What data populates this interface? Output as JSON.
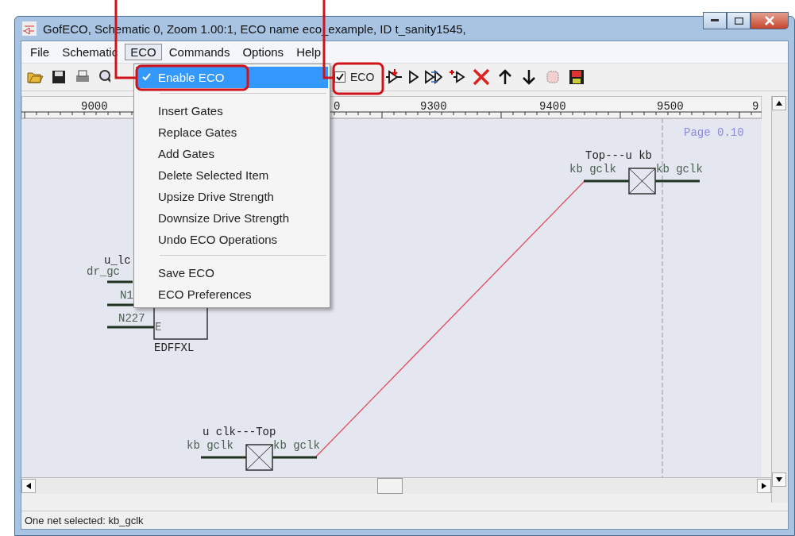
{
  "window": {
    "title": "GofECO, Schematic 0, Zoom 1.00:1, ECO name eco_example, ID t_sanity1545,"
  },
  "menu_bar": [
    {
      "label": "File",
      "selected": false
    },
    {
      "label": "Schematic",
      "selected": false
    },
    {
      "label": "ECO",
      "selected": true
    },
    {
      "label": "Commands",
      "selected": false
    },
    {
      "label": "Options",
      "selected": false
    },
    {
      "label": "Help",
      "selected": false
    }
  ],
  "toolbar": {
    "eco_checkbox": {
      "label": "ECO",
      "checked": true
    }
  },
  "eco_menu": {
    "groups": [
      [
        {
          "label": "Enable ECO",
          "checked": true,
          "selected": true
        }
      ],
      [
        {
          "label": "Insert Gates",
          "checked": false,
          "selected": false
        },
        {
          "label": "Replace Gates",
          "checked": false,
          "selected": false
        },
        {
          "label": "Add Gates",
          "checked": false,
          "selected": false
        },
        {
          "label": "Delete Selected Item",
          "checked": false,
          "selected": false
        },
        {
          "label": "Upsize Drive Strength",
          "checked": false,
          "selected": false
        },
        {
          "label": "Downsize Drive Strength",
          "checked": false,
          "selected": false
        },
        {
          "label": "Undo ECO Operations",
          "checked": false,
          "selected": false
        }
      ],
      [
        {
          "label": "Save ECO",
          "checked": false,
          "selected": false
        },
        {
          "label": "ECO Preferences",
          "checked": false,
          "selected": false
        }
      ]
    ]
  },
  "ruler": {
    "labels": [
      "9000",
      "0",
      "9300",
      "9400",
      "9500",
      "9"
    ]
  },
  "canvas": {
    "page_label": "Page 0.10",
    "left_instance": {
      "name": "u_lc",
      "pin_top": "dr_gc",
      "net_1": "N1",
      "net_2": "N227",
      "pin_e": "E",
      "cell": "EDFFXL"
    },
    "port_top": {
      "name": "Top---u kb",
      "left_pin": "kb gclk",
      "right_pin": "kb gclk"
    },
    "port_bottom": {
      "name": "u clk---Top",
      "left_pin": "kb gclk",
      "right_pin": "kb gclk"
    }
  },
  "status_bar": {
    "text": "One net selected: kb_gclk"
  }
}
